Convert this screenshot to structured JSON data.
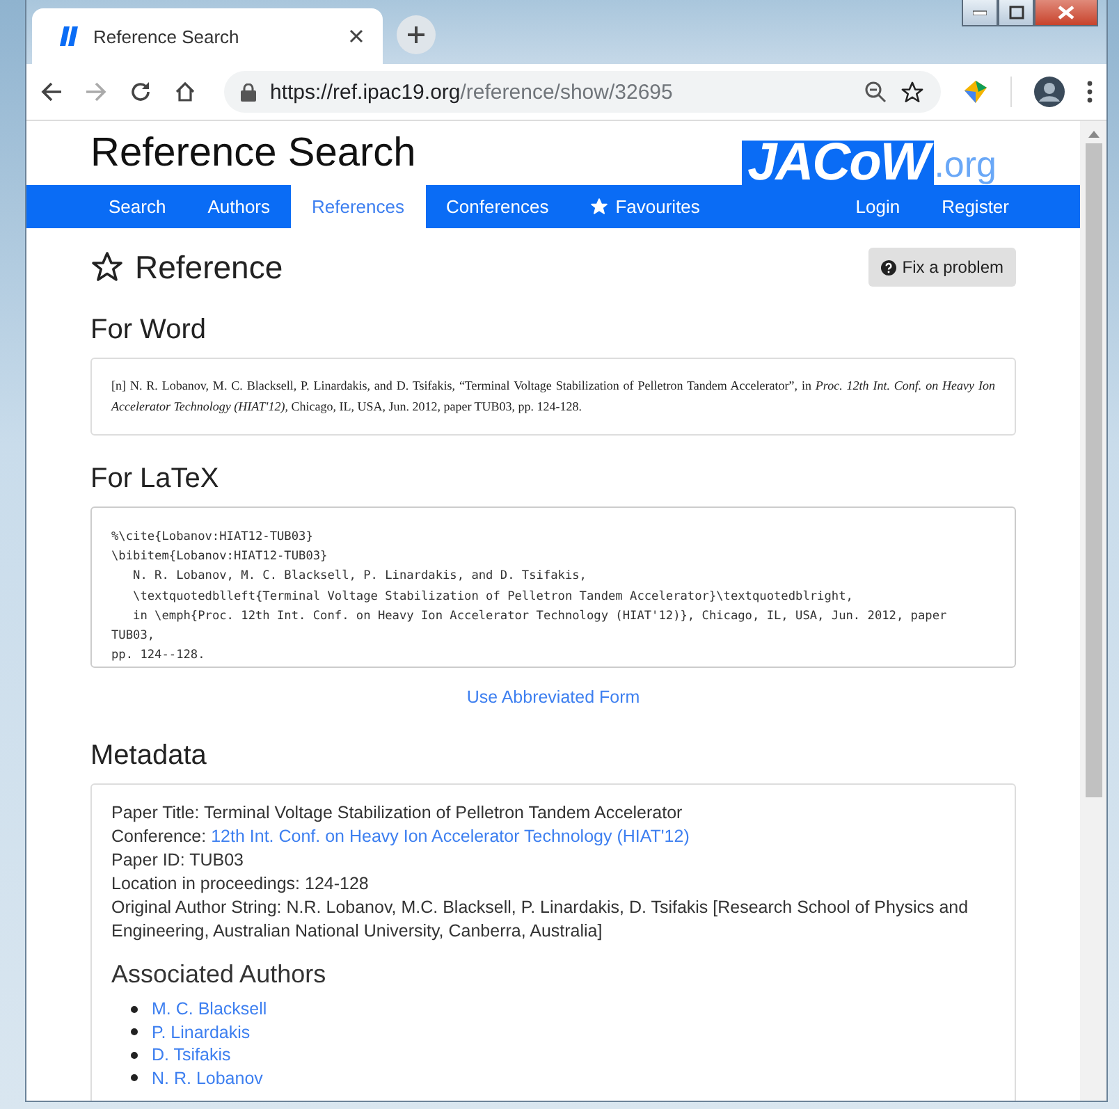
{
  "browser": {
    "tab_title": "Reference Search",
    "url_host": "https://ref.ipac19.org",
    "url_path": "/reference/show/32695"
  },
  "site": {
    "title": "Reference Search",
    "logo_main": "JACoW",
    "logo_suffix": ".org"
  },
  "nav": {
    "left": [
      {
        "label": "Search",
        "selected": false,
        "kind": "plain"
      },
      {
        "label": "Authors",
        "selected": false,
        "kind": "plain"
      },
      {
        "label": "References",
        "selected": true,
        "kind": "plain"
      },
      {
        "label": "Conferences",
        "selected": false,
        "kind": "plain"
      },
      {
        "label": "Favourites",
        "selected": false,
        "kind": "star"
      }
    ],
    "right": [
      {
        "label": "Login",
        "selected": false,
        "kind": "plain"
      },
      {
        "label": "Register",
        "selected": false,
        "kind": "plain"
      }
    ]
  },
  "page": {
    "title": "Reference",
    "fix_button": "Fix a problem"
  },
  "word": {
    "heading": "For Word",
    "citation": "[n]  N. R. Lobanov, M. C. Blacksell, P. Linardakis, and D. Tsifakis, “Terminal Voltage Stabilization of Pelletron Tandem Accelerator”, in *Proc. 12th Int. Conf. on Heavy Ion Accelerator Technology (HIAT'12)*, Chicago, IL, USA, Jun. 2012, paper TUB03, pp. 124-128."
  },
  "latex": {
    "heading": "For LaTeX",
    "value": "%\\cite{Lobanov:HIAT12-TUB03}\n\\bibitem{Lobanov:HIAT12-TUB03}\n   N. R. Lobanov, M. C. Blacksell, P. Linardakis, and D. Tsifakis,\n   \\textquotedblleft{Terminal Voltage Stabilization of Pelletron Tandem Accelerator}\\textquotedblright,\n   in \\emph{Proc. 12th Int. Conf. on Heavy Ion Accelerator Technology (HIAT'12)}, Chicago, IL, USA, Jun. 2012, paper TUB03,\npp. 124--128.",
    "abbrev_link": "Use Abbreviated Form"
  },
  "metadata": {
    "heading": "Metadata",
    "fields": [
      {
        "label": "Paper Title:",
        "value": "Terminal Voltage Stabilization of Pelletron Tandem Accelerator",
        "link": false
      },
      {
        "label": "Conference:",
        "value": "12th Int. Conf. on Heavy Ion Accelerator Technology (HIAT'12)",
        "link": true
      },
      {
        "label": "Paper ID:",
        "value": "TUB03",
        "link": false
      },
      {
        "label": "Location in proceedings:",
        "value": "124-128",
        "link": false
      },
      {
        "label": "Original Author String:",
        "value": "N.R. Lobanov, M.C. Blacksell, P. Linardakis, D. Tsifakis [Research School of Physics and Engineering, Australian National University, Canberra, Australia]",
        "link": false
      }
    ],
    "authors_heading": "Associated Authors",
    "authors": [
      "M. C. Blacksell",
      "P. Linardakis",
      "D. Tsifakis",
      "N. R. Lobanov"
    ]
  }
}
